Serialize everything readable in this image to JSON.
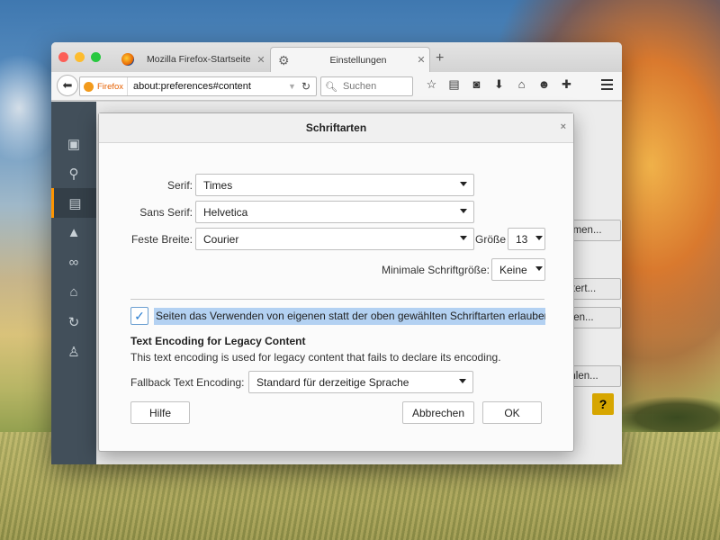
{
  "browser": {
    "tabs": [
      {
        "label": "Mozilla Firefox-Startseite",
        "active": false
      },
      {
        "label": "Einstellungen",
        "active": true
      }
    ],
    "identity_label": "Firefox",
    "url": "about:preferences#content",
    "search_placeholder": "Suchen"
  },
  "background_buttons": [
    {
      "label": "mmen..."
    },
    {
      "label": "eitert..."
    },
    {
      "label": "rben..."
    },
    {
      "label": "ählen..."
    }
  ],
  "help_symbol": "?",
  "dialog": {
    "title": "Schriftarten",
    "close_symbol": "×",
    "serif_label": "Serif:",
    "serif_value": "Times",
    "sans_label": "Sans Serif:",
    "sans_value": "Helvetica",
    "mono_label": "Feste Breite:",
    "mono_value": "Courier",
    "size_label": "Größe",
    "size_value": "13",
    "min_size_label": "Minimale Schriftgröße:",
    "min_size_value": "Keine",
    "allow_pages_label": "Seiten das Verwenden von eigenen statt der oben gewählten Schriftarten erlauben",
    "allow_pages_checked": true,
    "encoding_title": "Text Encoding for Legacy Content",
    "encoding_desc": "This text encoding is used for legacy content that fails to declare its encoding.",
    "fallback_label": "Fallback Text Encoding:",
    "fallback_value": "Standard für derzeitige Sprache",
    "help_button": "Hilfe",
    "cancel_button": "Abbrechen",
    "ok_button": "OK"
  },
  "colors": {
    "accent": "#ff9500",
    "sidebar": "#424f5a",
    "selection": "#b3d1f2",
    "help": "#e5b100"
  }
}
